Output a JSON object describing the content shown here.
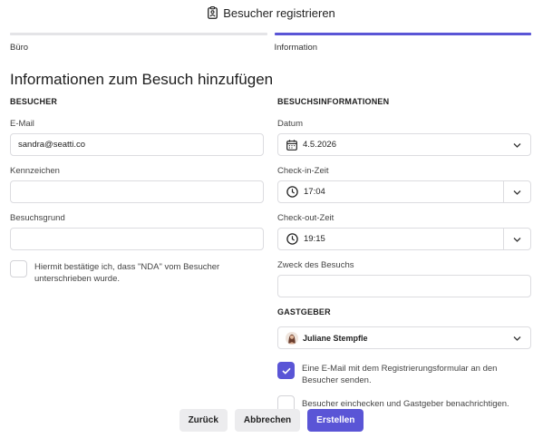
{
  "header": {
    "title": "Besucher registrieren",
    "icon": "badge-icon"
  },
  "steps": [
    {
      "label": "Büro",
      "active": false
    },
    {
      "label": "Information",
      "active": true
    }
  ],
  "page_title": "Informationen zum Besuch hinzufügen",
  "visitor": {
    "section_title": "BESUCHER",
    "email_label": "E-Mail",
    "email_value": "sandra@seatti.co",
    "plate_label": "Kennzeichen",
    "plate_value": "",
    "reason_label": "Besuchsgrund",
    "reason_value": "",
    "nda_text": "Hiermit bestätige ich, dass \"NDA\" vom Besucher unterschrieben wurde.",
    "nda_checked": false
  },
  "visit_info": {
    "section_title": "BESUCHSINFORMATIONEN",
    "date_label": "Datum",
    "date_value": "4.5.2026",
    "checkin_label": "Check-in-Zeit",
    "checkin_value": "17:04",
    "checkout_label": "Check-out-Zeit",
    "checkout_value": "19:15",
    "purpose_label": "Zweck des Besuchs",
    "purpose_value": ""
  },
  "host": {
    "section_title": "GASTGEBER",
    "name": "Juliane Stempfle"
  },
  "options": {
    "send_email_text": "Eine E-Mail mit dem Registrierungsformular an den Besucher senden.",
    "send_email_checked": true,
    "checkin_text": "Besucher einchecken und Gastgeber benachrichtigen.",
    "checkin_checked": false
  },
  "footer": {
    "back_label": "Zurück",
    "cancel_label": "Abbrechen",
    "create_label": "Erstellen"
  },
  "colors": {
    "accent": "#5a55d6",
    "border": "#dcdce0",
    "button_grey": "#ececee"
  }
}
